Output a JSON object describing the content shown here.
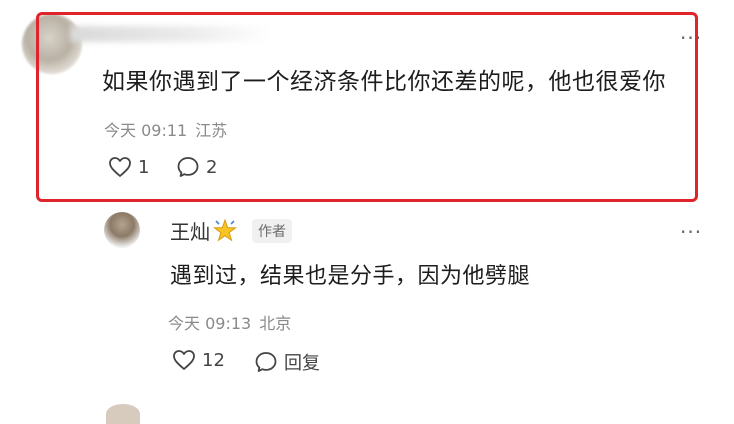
{
  "comment": {
    "text": "如果你遇到了一个经济条件比你还差的呢，他也很爱你",
    "time": "今天 09:11",
    "location": "江苏",
    "likes": "1",
    "replies": "2",
    "more": "···"
  },
  "reply": {
    "username": "王灿",
    "badge_icon": "sparkle-star-icon",
    "author_badge": "作者",
    "text": "遇到过，结果也是分手，因为他劈腿",
    "time": "今天 09:13",
    "location": "北京",
    "likes": "12",
    "reply_label": "回复",
    "more": "···"
  },
  "colors": {
    "highlight_border": "#e0242c",
    "meta_text": "#8a8a8a"
  }
}
